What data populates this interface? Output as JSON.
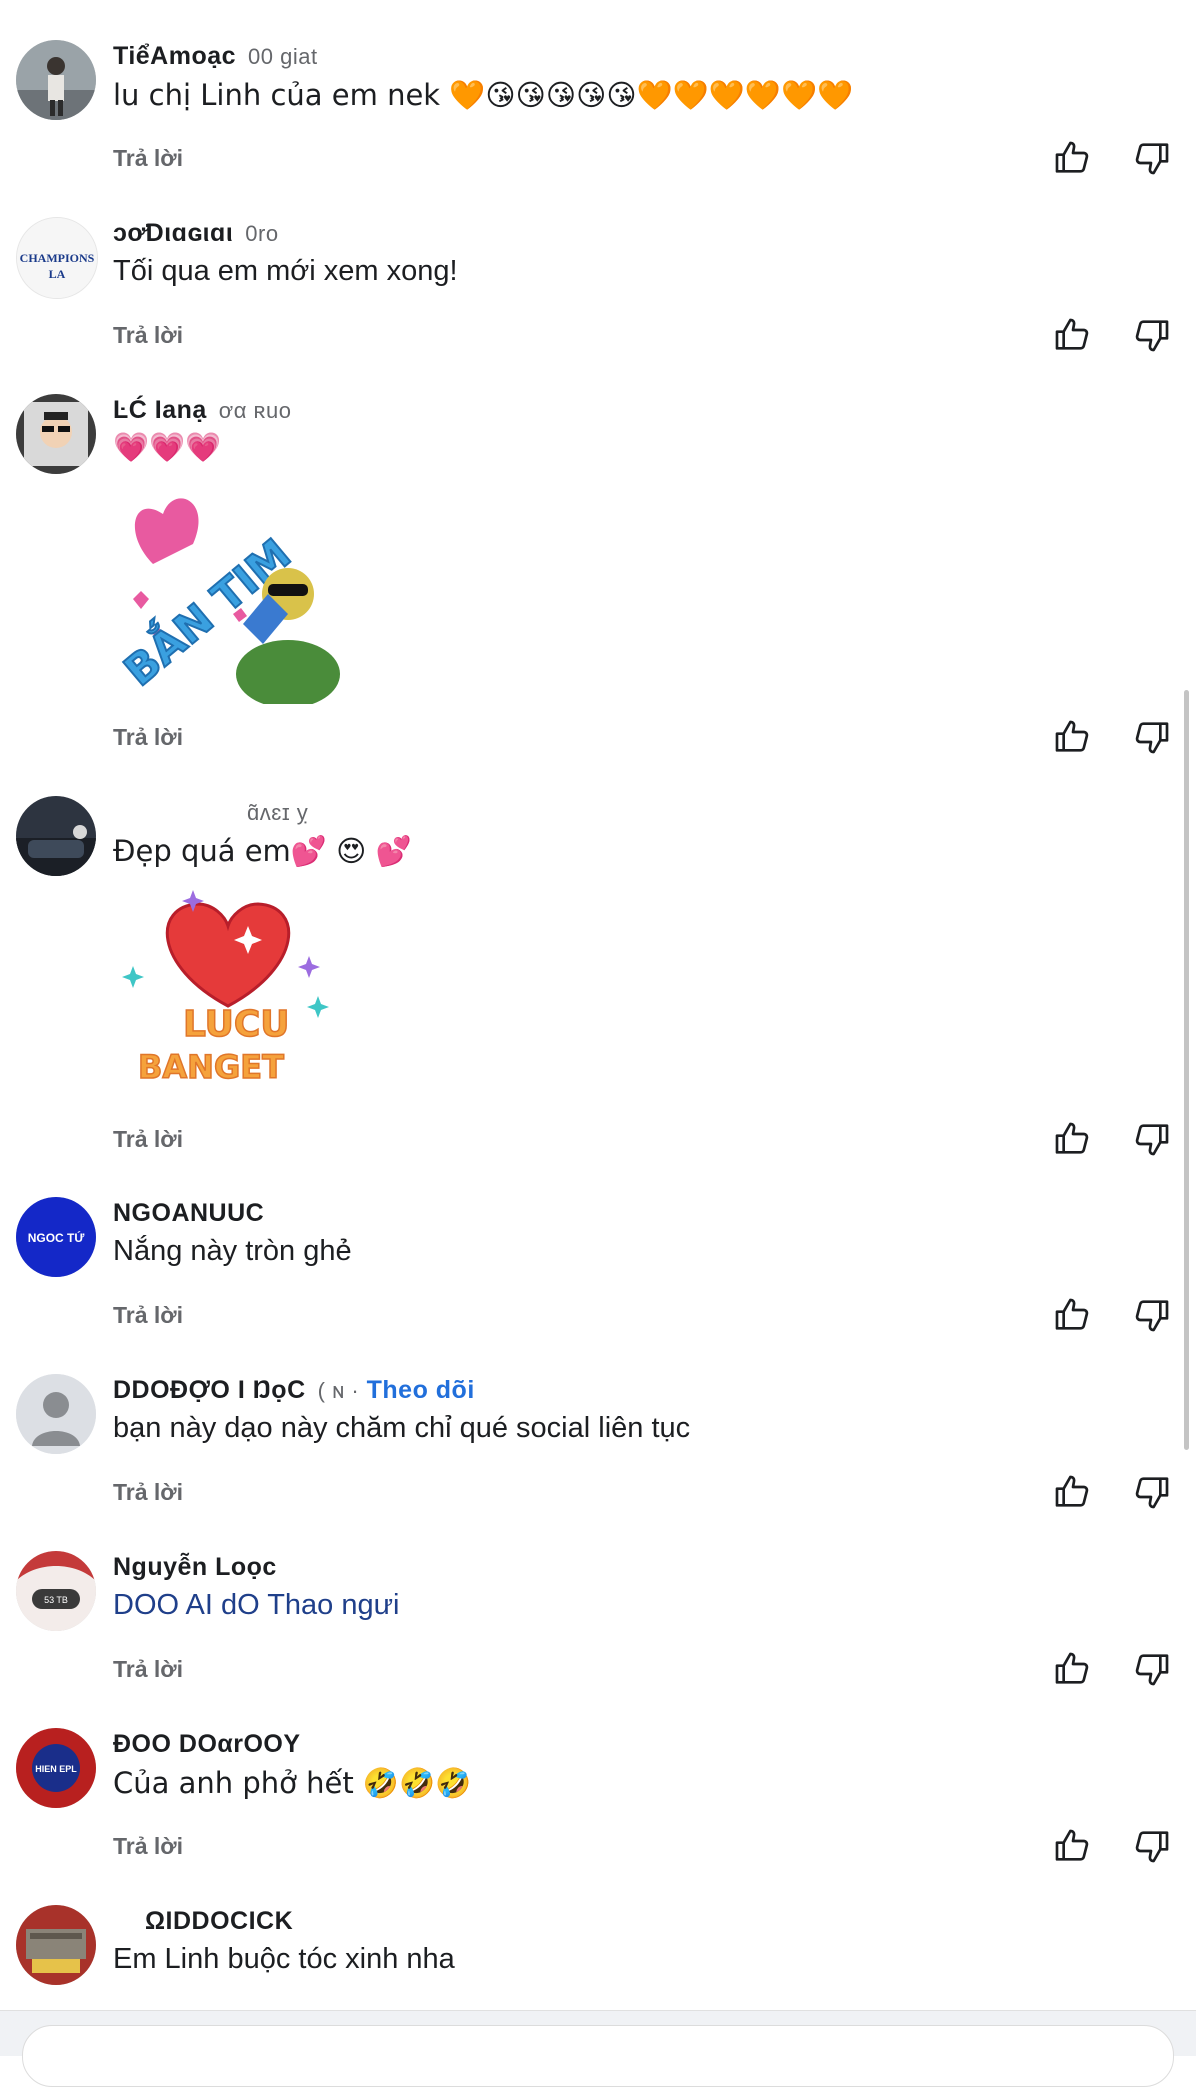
{
  "reply_label": "Trả lời",
  "comments": [
    {
      "name": "TiểAmoạc",
      "meta": "00 giat",
      "text": "lu chị Linh của em nek 🧡😘😘😘😘😘🧡🧡🧡🧡🧡🧡"
    },
    {
      "name": "ɔơ̛Dιɑɢιɑι",
      "meta": "0ro",
      "text": "Tối qua em mới xem xong!"
    },
    {
      "name": "ĿĆ Ianạ",
      "meta": "ơα ʀuo",
      "text": "💗💗💗",
      "sticker": "bắn tim"
    },
    {
      "name": "",
      "meta": "ɑ̃ʌɛɪ ỵ",
      "text": "Đẹp quá em💕 😍 💕",
      "sticker": "lucu banget"
    },
    {
      "name": "NGOANUUC",
      "meta": "",
      "text": "Nắng này tròn ghẻ"
    },
    {
      "name": "DDOĐỢO I ŊọC",
      "meta": "( ɴ ·",
      "follow": "Theo dõi",
      "text": "bạn này dạo này chăm chỉ qué social liên tục"
    },
    {
      "name": "Nguyễn Loọc",
      "meta": "",
      "text": "DOO AI dO Thao ngưi"
    },
    {
      "name": "ĐOO DOαrOOY",
      "meta": "",
      "text": "Của anh phở hết 🤣🤣🤣"
    },
    {
      "name": "ΩIDDOCICK",
      "meta": "",
      "text": "Em Linh buộc tóc xinh nha"
    }
  ],
  "avatar_labels": {
    "champions": "CHAMPIONS",
    "ngoc_tu": "NGOC TỨ",
    "badge": "53 TB",
    "hien_epl": "HIEN EPL"
  },
  "sticker_labels": {
    "ban_tim": "BẮN TIM",
    "lucu_1": "LUCU",
    "lucu_2": "BANGET"
  },
  "icons": {
    "like": "thumbs-up-icon",
    "dislike": "thumbs-down-icon",
    "default_avatar": "person-icon"
  },
  "colors": {
    "link": "#216fdb",
    "muted": "#65676b",
    "text": "#1c1e21"
  }
}
